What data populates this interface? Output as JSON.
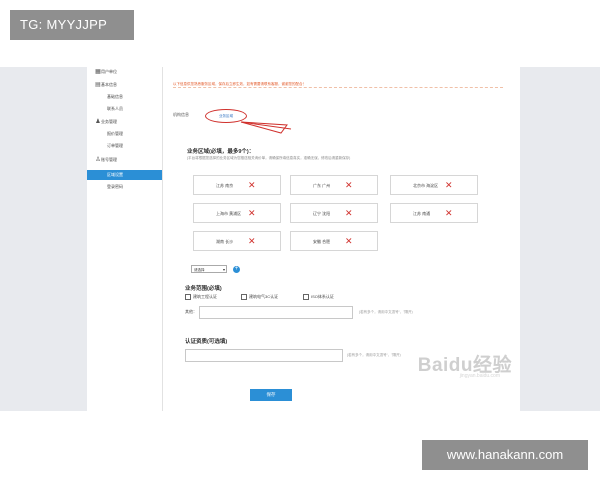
{
  "overlays": {
    "top_label": "TG: MYYJJPP",
    "bottom_label": "www.hanakann.com"
  },
  "sidebar": {
    "items": [
      {
        "label": "用户单位"
      },
      {
        "label": "基本信息"
      },
      {
        "label": "基础信息"
      },
      {
        "label": "联系人员"
      },
      {
        "label": "业务管理"
      },
      {
        "label": "报价管理"
      },
      {
        "label": "订单管理"
      },
      {
        "label": "账号管理"
      },
      {
        "label": "区域设置"
      },
      {
        "label": "登录密码"
      }
    ]
  },
  "content": {
    "notice": "以下信息供您熟悉服务区域，保存后立即生效，如有需要请联系客服，谢谢您的配合！",
    "tabs": [
      {
        "label": "机构信息"
      },
      {
        "label": "业务区域"
      }
    ],
    "service_area": {
      "title": "业务区域(必填，最多9个)：",
      "hint": "(平台将根据您选择的业务区域为您推送相关询价单，请确保所填信息真实，准确无误，修改后请重新保存)",
      "regions": [
        {
          "label": "江苏 南京"
        },
        {
          "label": "广东 广州"
        },
        {
          "label": "北京市 海淀区"
        },
        {
          "label": "上海市 黄浦区"
        },
        {
          "label": "辽宁 沈阳"
        },
        {
          "label": "江苏 南通"
        },
        {
          "label": "湖南 长沙"
        },
        {
          "label": "安徽 合肥"
        }
      ],
      "select_value": "请选择"
    },
    "service_scope": {
      "title": "业务范围(必填)",
      "options": [
        {
          "label": "建筑工程认证",
          "checked": true
        },
        {
          "label": "建筑电气3C认证",
          "checked": true
        },
        {
          "label": "ISO体系认证",
          "checked": true
        }
      ],
      "other_label": "其他：",
      "other_hint": "(若有多个，请用中文逗号“，”隔开)"
    },
    "certification": {
      "title": "认证资质(可选填)",
      "hint": "(若有多个，请用中文逗号“，”隔开)"
    },
    "submit_label": "保存",
    "watermark": "Baidu经验",
    "watermark_sub": "jingyan.baidu.com"
  },
  "colors": {
    "accent": "#2b8fd6",
    "remove": "#d0312d",
    "annotation": "#d0312d"
  }
}
